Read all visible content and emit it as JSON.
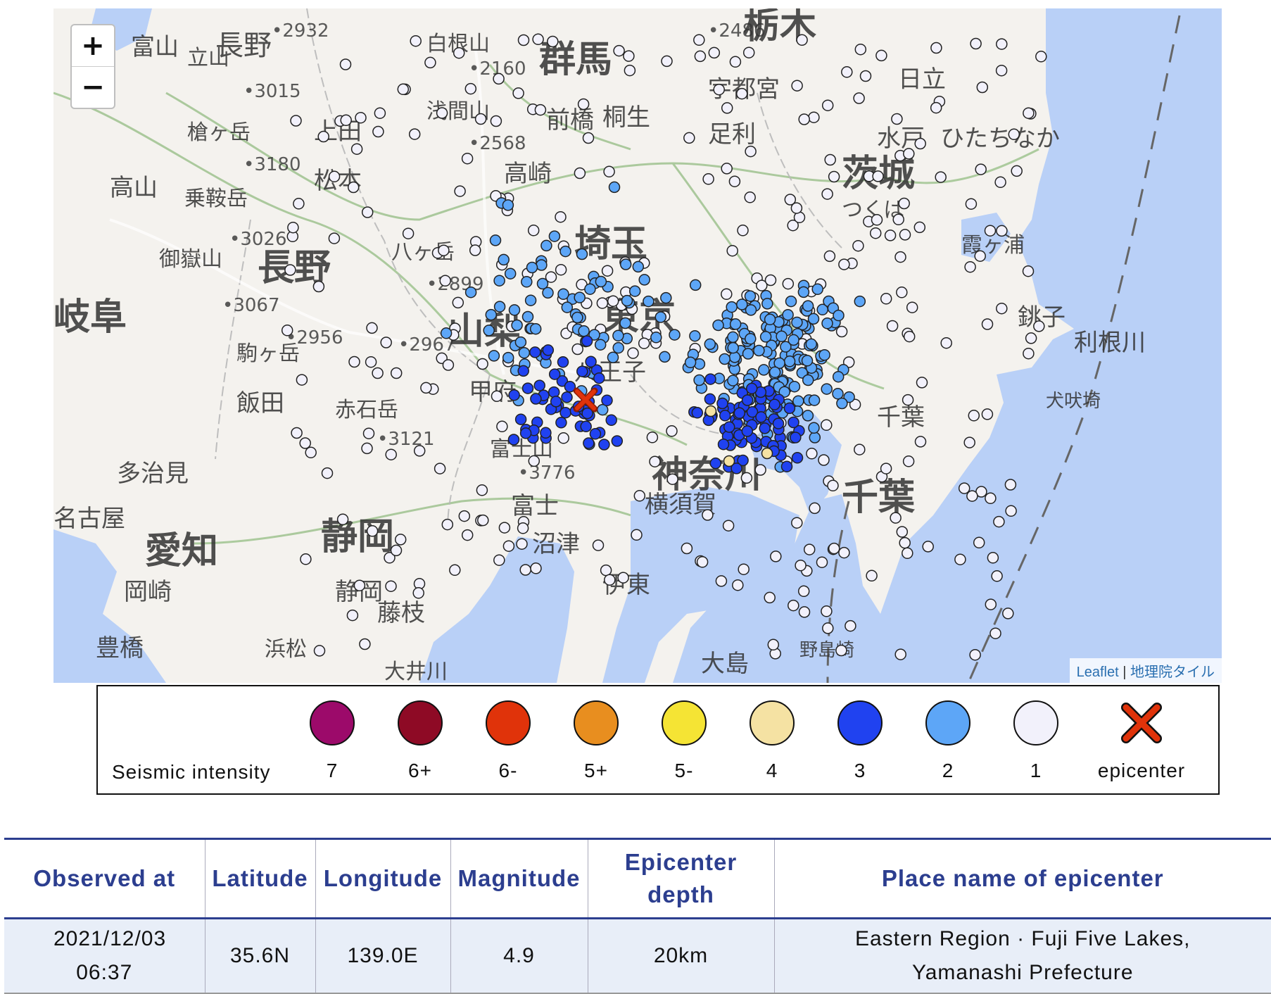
{
  "map": {
    "zoom_in": "+",
    "zoom_out": "−",
    "attribution_leaflet": "Leaflet",
    "attribution_sep": "|",
    "attribution_tiles": "地理院タイル",
    "place_labels": [
      {
        "text": "富山"
      },
      {
        "text": "立山"
      },
      {
        "text": "長野"
      },
      {
        "text": "白根山"
      },
      {
        "text": "群馬"
      },
      {
        "text": "栃木"
      },
      {
        "text": "日立"
      },
      {
        "text": "宇都宮"
      },
      {
        "text": "浅間山"
      },
      {
        "text": "前橋"
      },
      {
        "text": "桐生"
      },
      {
        "text": "足利"
      },
      {
        "text": "水戸"
      },
      {
        "text": "ひたちなか"
      },
      {
        "text": "槍ヶ岳"
      },
      {
        "text": "上田"
      },
      {
        "text": "高崎"
      },
      {
        "text": "茨城"
      },
      {
        "text": "高山"
      },
      {
        "text": "松本"
      },
      {
        "text": "乗鞍岳"
      },
      {
        "text": "つくば"
      },
      {
        "text": "御嶽山"
      },
      {
        "text": "長野"
      },
      {
        "text": "八ヶ岳"
      },
      {
        "text": "埼玉"
      },
      {
        "text": "霞ヶ浦"
      },
      {
        "text": "岐阜"
      },
      {
        "text": "駒ヶ岳"
      },
      {
        "text": "山梨"
      },
      {
        "text": "東京"
      },
      {
        "text": "銚子"
      },
      {
        "text": "利根川"
      },
      {
        "text": "八王子"
      },
      {
        "text": "飯田"
      },
      {
        "text": "赤石岳"
      },
      {
        "text": "甲府"
      },
      {
        "text": "千葉"
      },
      {
        "text": "犬吠埼"
      },
      {
        "text": "多治見"
      },
      {
        "text": "富士山"
      },
      {
        "text": "神奈川"
      },
      {
        "text": "名古屋"
      },
      {
        "text": "横須賀"
      },
      {
        "text": "千葉"
      },
      {
        "text": "愛知"
      },
      {
        "text": "静岡"
      },
      {
        "text": "富士"
      },
      {
        "text": "沼津"
      },
      {
        "text": "岡崎"
      },
      {
        "text": "静岡"
      },
      {
        "text": "伊東"
      },
      {
        "text": "藤枝"
      },
      {
        "text": "豊橋"
      },
      {
        "text": "浜松"
      },
      {
        "text": "大井川"
      },
      {
        "text": "大島"
      },
      {
        "text": "野島崎"
      }
    ],
    "elevations": [
      "2932",
      "2486",
      "2160",
      "3015",
      "2568",
      "3180",
      "3026",
      "2899",
      "3067",
      "2956",
      "2967",
      "3121",
      "3776"
    ],
    "stations": {
      "i1_count": 330,
      "i2_count": 250,
      "i3_count": 130,
      "i4_count": 3
    }
  },
  "legend": {
    "title": "Seismic intensity",
    "items": [
      {
        "label": "7",
        "color": "#9c0a6a"
      },
      {
        "label": "6+",
        "color": "#8e0a25"
      },
      {
        "label": "6-",
        "color": "#e0330a"
      },
      {
        "label": "5+",
        "color": "#e88e1f"
      },
      {
        "label": "5-",
        "color": "#f5e434"
      },
      {
        "label": "4",
        "color": "#f5e2a3"
      },
      {
        "label": "3",
        "color": "#2042f0"
      },
      {
        "label": "2",
        "color": "#5da6f7"
      },
      {
        "label": "1",
        "color": "#f2f1fb"
      },
      {
        "label": "epicenter",
        "color": "#e0330a",
        "icon": "x-mark"
      }
    ]
  },
  "table": {
    "headers": [
      "Observed at",
      "Latitude",
      "Longitude",
      "Magnitude",
      "Epicenter depth",
      "Place name of epicenter"
    ],
    "row": {
      "observed_at": "2021/12/03 06:37",
      "latitude": "35.6N",
      "longitude": "139.0E",
      "magnitude": "4.9",
      "depth": "20km",
      "place": "Eastern Region · Fuji Five Lakes, Yamanashi Prefecture"
    }
  },
  "colors": {
    "sea": "#b9d0f7",
    "land": "#f4f2ee",
    "header_text": "#2c3e8f",
    "row_bg": "#e8eef8",
    "epicenter": "#e0330a"
  }
}
